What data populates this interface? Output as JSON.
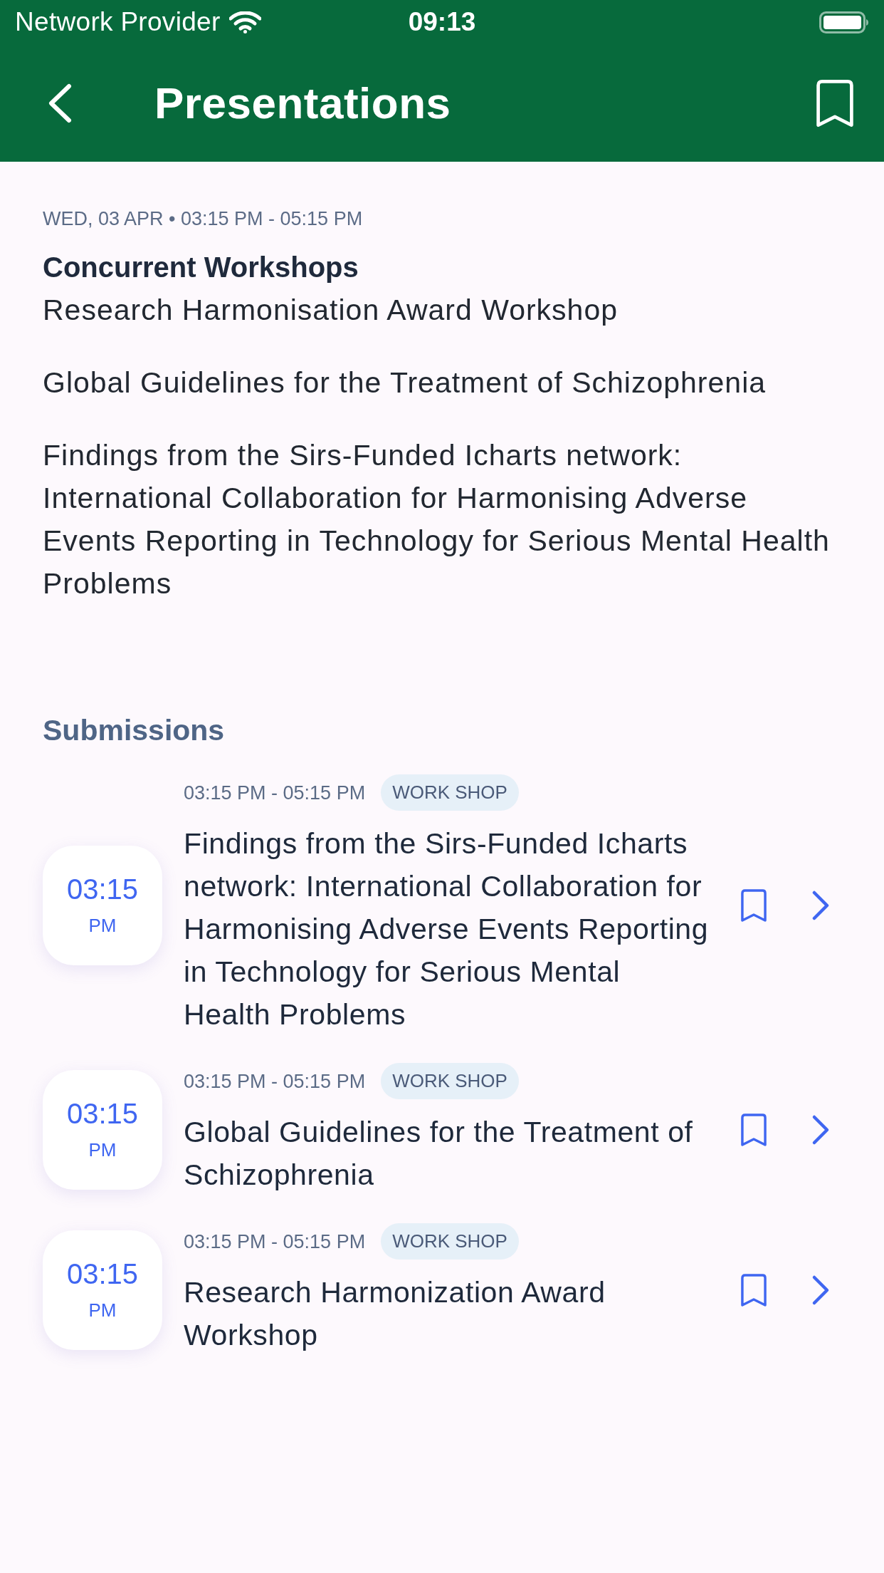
{
  "status_bar": {
    "carrier": "Network Provider",
    "time": "09:13"
  },
  "nav_bar": {
    "title": "Presentations"
  },
  "session": {
    "meta": "WED, 03 APR • 03:15 PM - 05:15 PM",
    "title": "Concurrent Workshops",
    "subtitle": "Research Harmonisation Award Workshop",
    "paragraphs": [
      "Global Guidelines for the Treatment of Schizophrenia",
      "Findings from the Sirs-Funded Icharts network: International Collaboration for Harmonising Adverse Events Reporting in Technology for Serious Mental Health Problems"
    ]
  },
  "submissions": {
    "heading": "Submissions",
    "items": [
      {
        "start_time": "03:15",
        "period": "PM",
        "time_range": "03:15 PM - 05:15 PM",
        "tag": "WORK SHOP",
        "title": "Findings from the Sirs-Funded Icharts network: International Collaboration for Harmonising Adverse Events Reporting in Technology for Serious Mental Health Problems",
        "bookmarked": false
      },
      {
        "start_time": "03:15",
        "period": "PM",
        "time_range": "03:15 PM - 05:15 PM",
        "tag": "WORK SHOP",
        "title": "Global Guidelines for the Treatment of Schizophrenia",
        "bookmarked": false
      },
      {
        "start_time": "03:15",
        "period": "PM",
        "time_range": "03:15 PM - 05:15 PM",
        "tag": "WORK SHOP",
        "title": "Research Harmonization Award Workshop",
        "bookmarked": false
      }
    ]
  }
}
